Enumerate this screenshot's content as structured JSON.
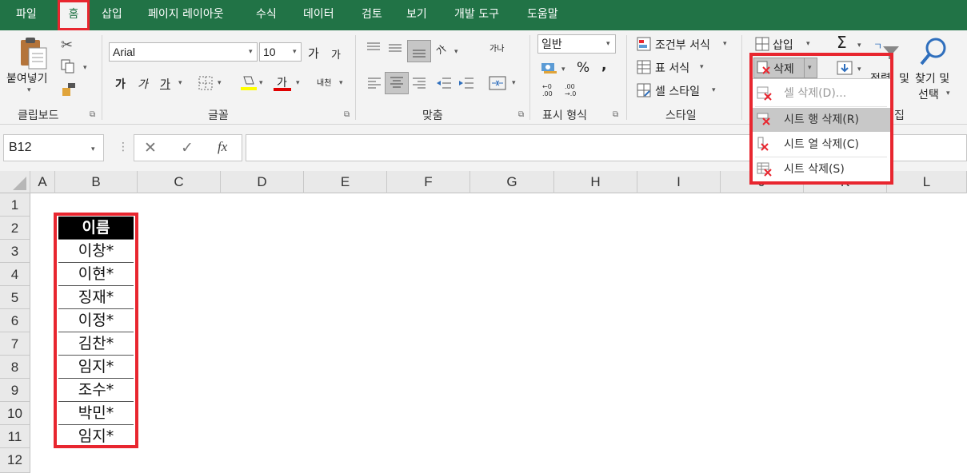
{
  "menu": {
    "tabs": [
      "파일",
      "홈",
      "삽입",
      "페이지 레이아웃",
      "수식",
      "데이터",
      "검토",
      "보기",
      "개발 도구",
      "도움말"
    ],
    "active": "홈"
  },
  "ribbon": {
    "clipboard": {
      "label": "클립보드",
      "paste": "붙여넣기"
    },
    "font": {
      "label": "글꼴",
      "name": "Arial",
      "size": "10",
      "bold": "가",
      "italic": "가",
      "underline": "가",
      "grow": "가",
      "shrink": "가",
      "color_a": "가",
      "phonetic": "내천"
    },
    "align": {
      "label": "맞춤",
      "orient": "가",
      "wrap": "가나"
    },
    "number": {
      "label": "표시 형식",
      "format": "일반",
      "percent": "%",
      "comma": ","
    },
    "styles": {
      "label": "스타일",
      "conditional": "조건부 서식",
      "table": "표 서식",
      "cell": "셀 스타일"
    },
    "cells": {
      "insert": "삽입",
      "delete": "삭제"
    },
    "editing": {
      "sum": "Σ",
      "sort": "정렬",
      "and1": "및",
      "find": "찾기 및",
      "select": "선택",
      "label": "집"
    }
  },
  "formula_bar": {
    "name_box": "B12",
    "cancel": "✕",
    "enter": "✓",
    "fx": "fx",
    "value": ""
  },
  "columns": [
    "A",
    "B",
    "C",
    "D",
    "E",
    "F",
    "G",
    "H",
    "I",
    "J",
    "K",
    "L"
  ],
  "rows": [
    "1",
    "2",
    "3",
    "4",
    "5",
    "6",
    "7",
    "8",
    "9",
    "10",
    "11",
    "12"
  ],
  "table": {
    "header": "이름",
    "values": [
      "이창*",
      "이현*",
      "징재*",
      "이정*",
      "김찬*",
      "임지*",
      "조수*",
      "박민*",
      "임지*"
    ]
  },
  "delete_menu": {
    "items": [
      {
        "label": "셀 삭제(D)...",
        "state": "disabled"
      },
      {
        "label": "시트 행 삭제(R)",
        "state": "hover"
      },
      {
        "label": "시트 열 삭제(C)",
        "state": "normal"
      },
      {
        "label": "시트 삭제(S)",
        "state": "normal"
      }
    ]
  },
  "colors": {
    "excel_green": "#217346",
    "highlight_red": "#e8262f",
    "font_yellow": "#ffff00",
    "font_red": "#e00000"
  }
}
